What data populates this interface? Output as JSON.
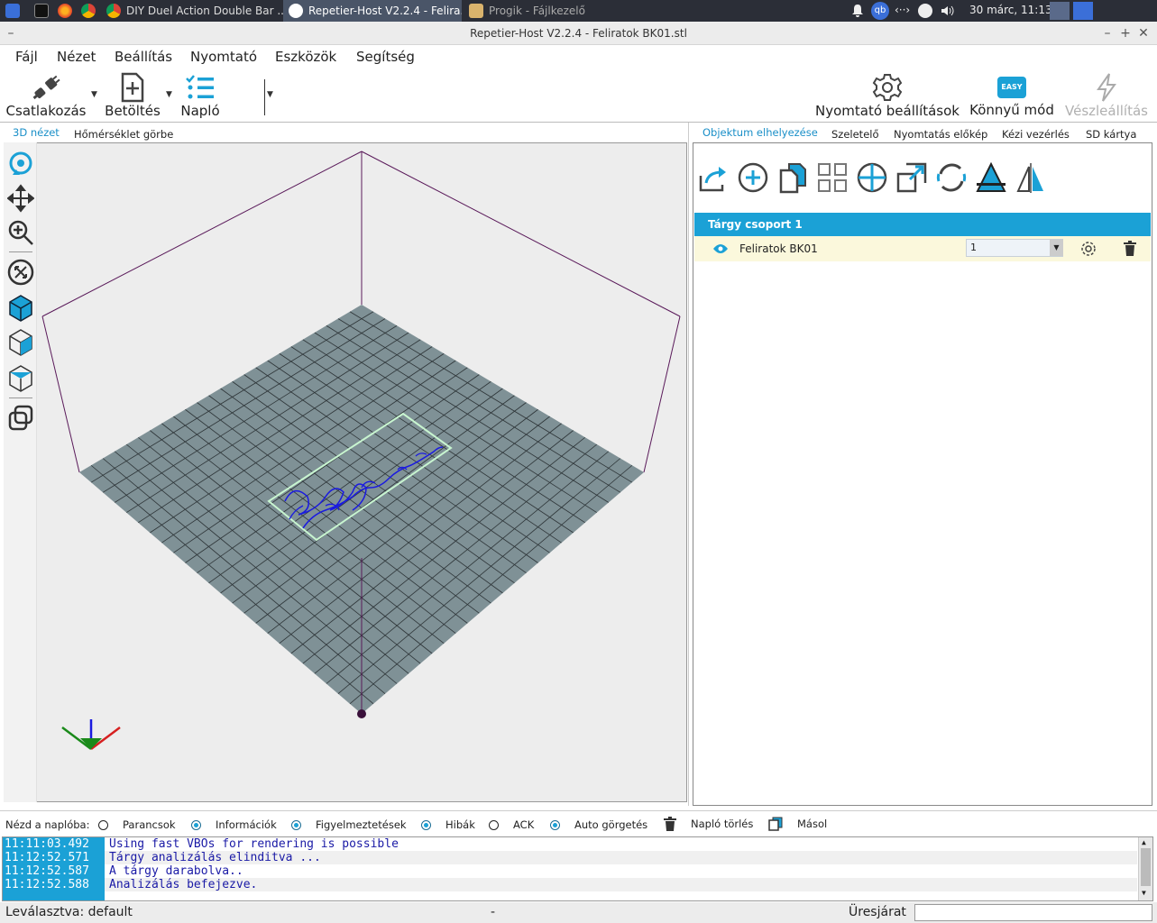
{
  "taskbar": {
    "items": [
      {
        "label": "",
        "icon": "app-menu-icon"
      },
      {
        "label": "",
        "icon": "terminal-icon"
      },
      {
        "label": "",
        "icon": "firefox-icon"
      },
      {
        "label": "",
        "icon": "chrome-icon"
      },
      {
        "label": "DIY Duel Action Double Bar ...",
        "icon": "chrome-icon"
      },
      {
        "label": "Repetier-Host V2.2.4 - Felira...",
        "icon": "repetier-icon"
      },
      {
        "label": "Progik - Fájlkezelő",
        "icon": "folder-icon"
      }
    ],
    "clock": "30 márc, 11:13"
  },
  "window": {
    "title": "Repetier-Host V2.2.4 - Feliratok BK01.stl"
  },
  "menu": [
    "Fájl",
    "Nézet",
    "Beállítás",
    "Nyomtató",
    "Eszközök",
    "Segítség"
  ],
  "toolbar": {
    "connect": "Csatlakozás",
    "load": "Betöltés",
    "log": "Napló",
    "printer_settings": "Nyomtató beállítások",
    "easy_mode": "Könnyű mód",
    "easy_badge": "EASY",
    "emergency": "Vészleállítás"
  },
  "left_tabs": [
    "3D nézet",
    "Hőmérséklet görbe"
  ],
  "right_tabs": [
    "Objektum elhelyezése",
    "Szeletelő",
    "Nyomtatás előkép",
    "Kézi vezérlés",
    "SD kártya"
  ],
  "objects": {
    "group_name": "Tárgy csoport 1",
    "items": [
      {
        "name": "Feliratok BK01",
        "copies": "1"
      }
    ]
  },
  "log_filter": {
    "label": "Nézd a naplóba:",
    "options": [
      {
        "label": "Parancsok",
        "checked": false
      },
      {
        "label": "Információk",
        "checked": true
      },
      {
        "label": "Figyelmeztetések",
        "checked": true
      },
      {
        "label": "Hibák",
        "checked": true
      },
      {
        "label": "ACK",
        "checked": false
      },
      {
        "label": "Auto görgetés",
        "checked": true
      }
    ],
    "clear": "Napló törlés",
    "copy": "Másol"
  },
  "log": [
    {
      "time": "11:11:03.492",
      "msg": "Using fast VBOs for rendering is possible"
    },
    {
      "time": "11:12:52.571",
      "msg": "Tárgy analizálás elinditva ..."
    },
    {
      "time": "11:12:52.587",
      "msg": "A tárgy darabolva.."
    },
    {
      "time": "11:12:52.588",
      "msg": "Analizálás befejezve."
    }
  ],
  "status": {
    "left": "Leválasztva: default",
    "middle": "-",
    "right": "Üresjárat"
  },
  "colors": {
    "accent": "#1ba1d6",
    "bed": "#7f9196",
    "frame": "#5a1a5a",
    "object_outline": "#b8f0c0",
    "object": "#1a1ae0"
  }
}
